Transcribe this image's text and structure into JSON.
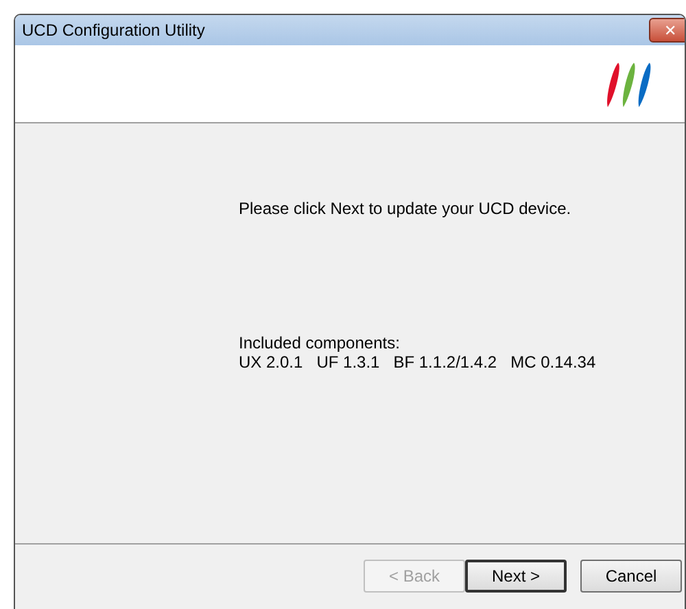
{
  "window": {
    "title": "UCD Configuration Utility",
    "close": "✕"
  },
  "message": "Please click Next to update your UCD device.",
  "components": {
    "heading": "Included components:",
    "list": "UX 2.0.1   UF 1.3.1   BF 1.1.2/1.4.2   MC 0.14.34"
  },
  "buttons": [
    {
      "label": "< Back",
      "disabled": true,
      "default": false
    },
    {
      "label": "Next >",
      "disabled": false,
      "default": true
    },
    {
      "label": "Cancel",
      "disabled": false,
      "default": false
    }
  ]
}
